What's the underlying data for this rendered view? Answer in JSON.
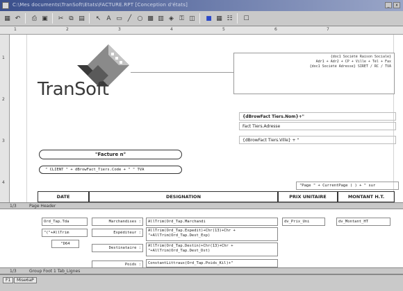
{
  "window": {
    "title": "C:\\Mes documents\\TranSoft\\Etats\\FACTURE.RPT [Conception d'états]",
    "minimize": "_",
    "close": "x"
  },
  "logo": {
    "text": "TranSoft"
  },
  "company_address": {
    "lines": [
      "{doc1 Société Raison Sociale}",
      "Adr1 + Adr2 + CP + Ville + Tél + Fax",
      "{doc1 Société Adresse} SIRET / RC / TVA"
    ]
  },
  "client": {
    "name": "{dBrowFact Tiers.Nom}+\"",
    "address": "Fact Tiers.Adresse",
    "city": "{dBrowFact Tiers.Ville} + \""
  },
  "invoice_title": "\"Facture n°",
  "client_code": "\" CLIENT \" + dBrowFact_Tiers.Code + \" \" TVA",
  "page_formula": "\"Page \" + CurrentPage ( ) + \" sur",
  "columns": [
    "DATE",
    "DESIGNATION",
    "PRIX UNITAIRE",
    "MONTANT H.T."
  ],
  "sections": {
    "page_header": {
      "index": "1/3",
      "label": "Page Header"
    },
    "group_footer": {
      "index": "1/3",
      "label": "Group Foot  1 Tab_Lignes"
    }
  },
  "detail_fields": [
    "Ord_Tap.Tda",
    "\"(\"+AllTrim",
    "\"D64",
    "Marchandises :",
    "Expéditeur :",
    "Destinataire :",
    "Poids :",
    "AllTrim(Ord_Tap.Marchandi",
    "AllTrim(Ord_Tap.Expedit)+Chr(13)+Chr + \"+AllTrim(Ord_Tap.Dest_Exp)",
    "AllTrim(Ord_Tap.Destin)+Chr(13)+Chr + \"+AllTrim(Ord_Tap.Dest_Dst)",
    "ConstantLittraux(Ord_Tap.Poids_Kil)+\"",
    "dv_Prix_Uni",
    "dv_Montant_HT"
  ],
  "tabs": [
    "F1",
    "Mise6aP"
  ],
  "ruler": [
    "1",
    "2",
    "3",
    "4",
    "5",
    "6",
    "7"
  ],
  "ruler_v": [
    "1",
    "2",
    "3",
    "4"
  ],
  "colors": {
    "titlebar": "#3a4f8c",
    "logo_dark": "#3a3a3a",
    "logo_mid": "#8a8a8a",
    "logo_light": "#c4c4c4"
  }
}
